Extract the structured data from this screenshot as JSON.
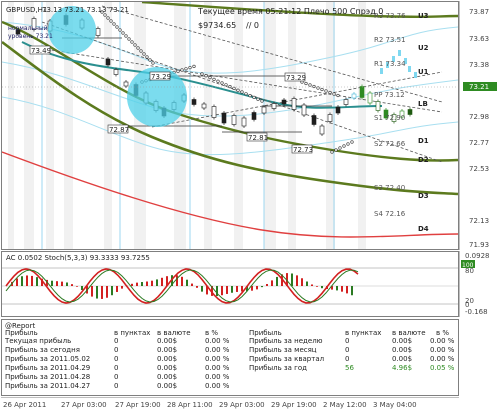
{
  "chart": {
    "symbol_title": "GBPUSD,H1",
    "ohlc": "73.13 73.21 73.13 73.21",
    "server_time": "Текущее время 05:21:12 Плечо 500 Спрэд 0",
    "balance": "$9734.65",
    "zero_label": "// 0",
    "left_label_1": "нормальный",
    "left_label_2": "уровень 73.21",
    "level_tags": [
      "73.49",
      "73.29",
      "72.87",
      "73.29",
      "72.81",
      "72.73"
    ],
    "right_levels": [
      "U3",
      "U2",
      "U1",
      "LB",
      "D1",
      "D2",
      "D3",
      "D4"
    ],
    "right_prices": [
      "73.87",
      "73.63",
      "73.38",
      "73.21",
      "72.98",
      "72.77",
      "72.53",
      "72.13",
      "71.93"
    ],
    "right_small_labels": [
      "R3 73.76",
      "R2 73.51",
      "R1 73.34",
      "PP 73.12",
      "S1 72.90",
      "S2 72.66",
      "S3 72.40",
      "S4 72.16"
    ],
    "current_price": "73.21"
  },
  "indicator": {
    "title": "AC 0.0502  Stoch(5,3,3) 93.3333 93.7255",
    "scale_top": "0.0928",
    "scale_hundred": "100",
    "scale_mid": "80",
    "scale_low": "20",
    "scale_zero": "0",
    "scale_bottom": "-0.168"
  },
  "report": {
    "title": "@Report",
    "headers_left": [
      "Прибыль",
      "в пунктах",
      "в валюте",
      "в %"
    ],
    "rows_left": [
      [
        "Текущая прибыль",
        "0",
        "0.00$",
        "0.00 %"
      ],
      [
        "Прибыль за сегодня",
        "0",
        "0.00$",
        "0.00 %"
      ],
      [
        "Прибыль за 2011.05.02",
        "0",
        "0.00$",
        "0.00 %"
      ],
      [
        "Прибыль за 2011.04.29",
        "0",
        "0.00$",
        "0.00 %"
      ],
      [
        "Прибыль за 2011.04.28",
        "0",
        "0.00$",
        "0.00 %"
      ],
      [
        "Прибыль за 2011.04.27",
        "0",
        "0.00$",
        "0.00 %"
      ]
    ],
    "headers_right": [
      "Прибыль",
      "в пунктах",
      "в валюте",
      "в %"
    ],
    "rows_right": [
      [
        "Прибыль за неделю",
        "0",
        "0.00$",
        "0.00 %"
      ],
      [
        "Прибыль за месяц",
        "0",
        "0.00$",
        "0.00 %"
      ],
      [
        "Прибыль за квартал",
        "0",
        "0.00$",
        "0.00 %"
      ],
      [
        "Прибыль за год",
        "56",
        "4.96$",
        "0.05 %"
      ]
    ]
  },
  "time_axis": [
    "26 Apr 2011",
    "27 Apr 03:00",
    "27 Apr 19:00",
    "28 Apr 11:00",
    "29 Apr 03:00",
    "29 Apr 19:00",
    "2 May 12:00",
    "3 May 04:00"
  ]
}
